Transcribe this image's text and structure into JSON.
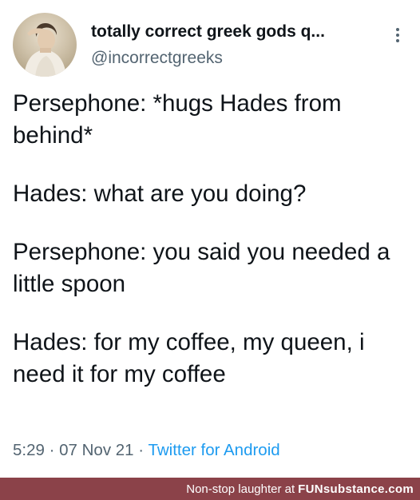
{
  "tweet": {
    "display_name": "totally correct greek gods q...",
    "handle": "@incorrectgreeks",
    "more_icon": "more-vertical-icon",
    "lines": [
      "Persephone: *hugs Hades from behind*",
      "Hades: what are you doing?",
      "Persephone: you said you needed a little spoon",
      "Hades: for my coffee, my queen, i need it for my coffee"
    ],
    "time": "5:29",
    "separator": " · ",
    "date": "07 Nov 21",
    "source": "Twitter for Android"
  },
  "footer": {
    "tagline": "Non-stop laughter at",
    "brand": "FUNsubstance.com",
    "background": "#8b4249"
  },
  "colors": {
    "text": "#0f1419",
    "secondary": "#536471",
    "link": "#1d9bf0"
  }
}
